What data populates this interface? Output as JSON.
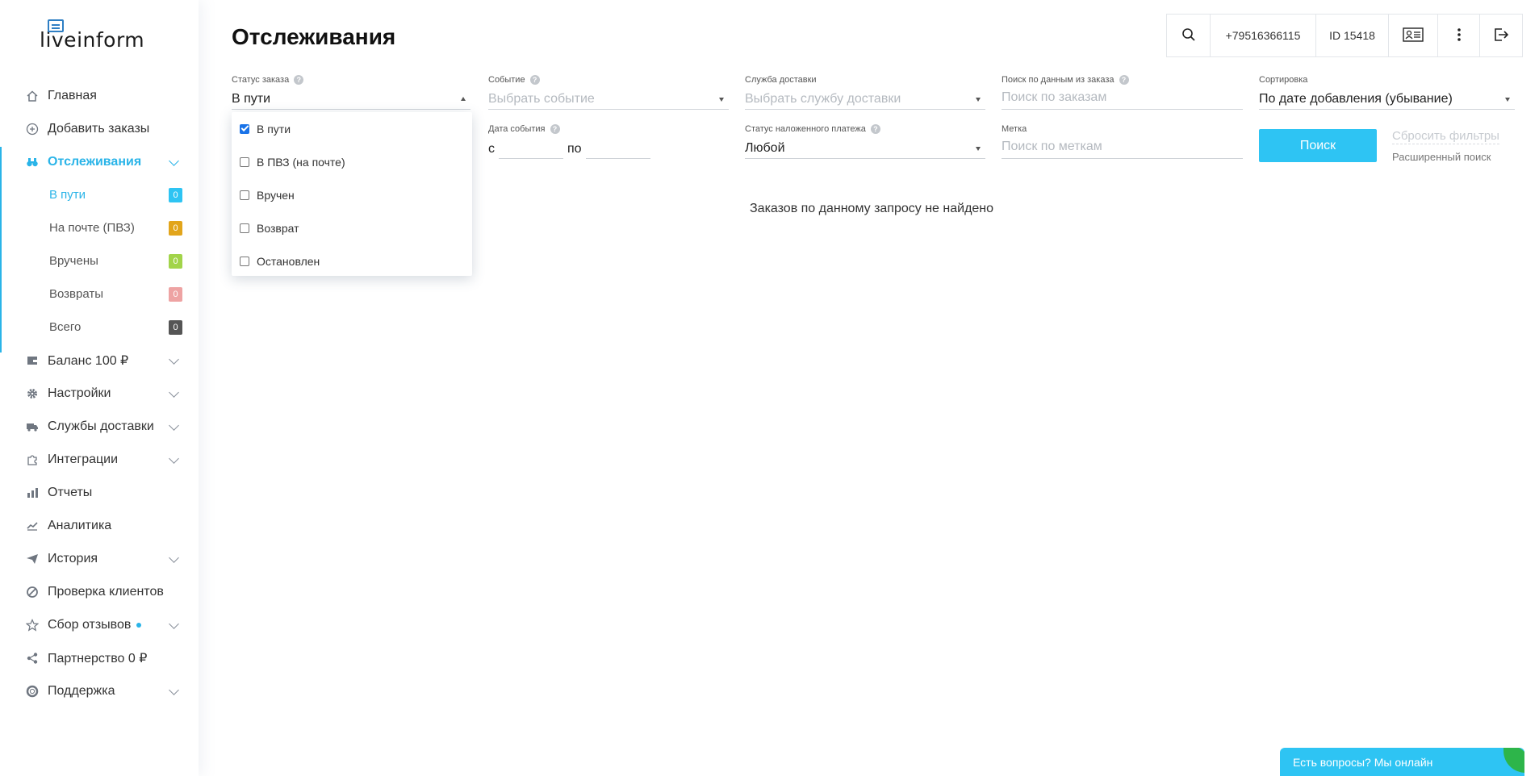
{
  "brand": {
    "logo_text": "liveinform"
  },
  "sidebar": {
    "items": [
      {
        "label": "Главная",
        "icon": "home-icon"
      },
      {
        "label": "Добавить заказы",
        "icon": "plus-circle-icon"
      },
      {
        "label": "Отслеживания",
        "icon": "binoculars-icon",
        "active": true
      },
      {
        "label": "Баланс 100 ₽",
        "icon": "wallet-icon"
      },
      {
        "label": "Настройки",
        "icon": "gear-icon"
      },
      {
        "label": "Службы доставки",
        "icon": "truck-icon"
      },
      {
        "label": "Интеграции",
        "icon": "puzzle-icon"
      },
      {
        "label": "Отчеты",
        "icon": "bar-chart-icon"
      },
      {
        "label": "Аналитика",
        "icon": "line-chart-icon"
      },
      {
        "label": "История",
        "icon": "paper-plane-icon"
      },
      {
        "label": "Проверка клиентов",
        "icon": "ban-icon"
      },
      {
        "label": "Сбор отзывов",
        "icon": "star-icon"
      },
      {
        "label": "Партнерство 0 ₽",
        "icon": "share-icon"
      },
      {
        "label": "Поддержка",
        "icon": "lifebuoy-icon"
      }
    ],
    "tracking_sub": [
      {
        "label": "В пути",
        "count": "0",
        "color": "#2ec4f3"
      },
      {
        "label": "На почте (ПВЗ)",
        "count": "0",
        "color": "#e2a51b"
      },
      {
        "label": "Вручены",
        "count": "0",
        "color": "#a2d44a"
      },
      {
        "label": "Возвраты",
        "count": "0",
        "color": "#eea3a3"
      },
      {
        "label": "Всего",
        "count": "0",
        "color": "#555555"
      }
    ]
  },
  "page": {
    "title": "Отслеживания"
  },
  "topbar": {
    "phone": "+79516366115",
    "account_id": "ID 15418"
  },
  "filters": {
    "order_status": {
      "label": "Статус заказа",
      "value": "В пути"
    },
    "event": {
      "label": "Событие",
      "placeholder": "Выбрать событие"
    },
    "delivery_service": {
      "label": "Служба доставки",
      "placeholder": "Выбрать службу доставки"
    },
    "order_search": {
      "label": "Поиск по данным из заказа",
      "placeholder": "Поиск по заказам"
    },
    "sorting": {
      "label": "Сортировка",
      "value": "По дате добавления (убывание)"
    },
    "event_date": {
      "label": "Дата события",
      "from": "с",
      "to": "по"
    },
    "cod_status": {
      "label": "Статус наложенного платежа",
      "value": "Любой"
    },
    "tag": {
      "label": "Метка",
      "placeholder": "Поиск по меткам"
    },
    "search_button": "Поиск",
    "reset_link": "Сбросить фильтры",
    "advanced_link": "Расширенный поиск"
  },
  "status_dropdown": {
    "options": [
      {
        "label": "В пути",
        "checked": true
      },
      {
        "label": "В ПВЗ (на почте)",
        "checked": false
      },
      {
        "label": "Вручен",
        "checked": false
      },
      {
        "label": "Возврат",
        "checked": false
      },
      {
        "label": "Остановлен",
        "checked": false
      }
    ]
  },
  "results": {
    "empty_message": "Заказов по данному запросу не найдено"
  },
  "chat": {
    "label": "Есть вопросы? Мы онлайн"
  },
  "colors": {
    "accent": "#2ec4f3",
    "active_text": "#2ab4e8",
    "chat_leaf": "#2db54a"
  }
}
